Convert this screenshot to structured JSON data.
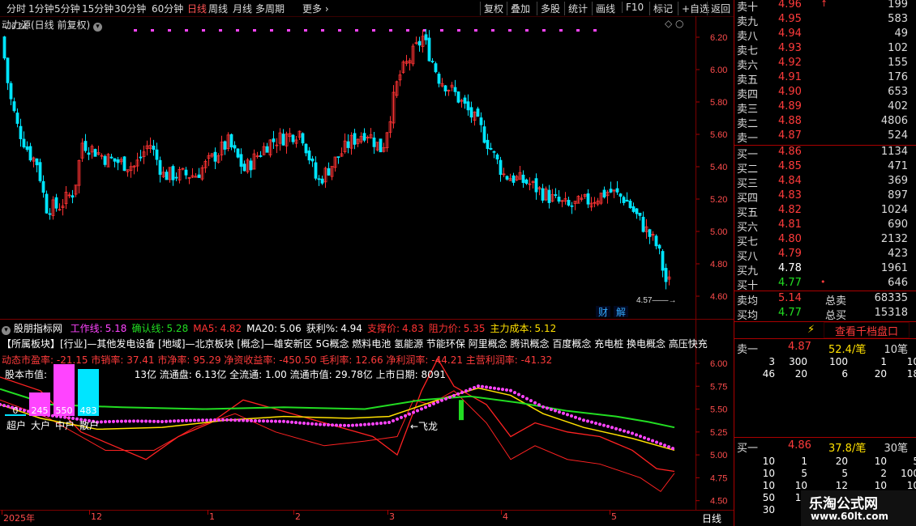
{
  "toolbar": {
    "tabs": [
      "分时",
      "1分钟",
      "5分钟",
      "15分钟",
      "30分钟",
      "60分钟",
      "日线",
      "周线",
      "月线",
      "多周期",
      "更多 ›"
    ],
    "active_tab": "日线",
    "buttons": [
      "复权",
      "叠加",
      "多股",
      "统计",
      "画线",
      "F10",
      "标记",
      "+自选",
      "返回"
    ]
  },
  "main_chart": {
    "title": "动力源(日线 前复权)",
    "max_label": "6.24",
    "min_label": "4.57",
    "badges": [
      "财",
      "解"
    ],
    "y_ticks": [
      "6.20",
      "6.00",
      "5.80",
      "5.60",
      "5.40",
      "5.20",
      "5.00",
      "4.80",
      "4.60"
    ],
    "colors": {
      "up": "#ff3333",
      "down": "#00e5ff",
      "dots": "#ff44ff"
    }
  },
  "indicator_header": {
    "name": "股朋指标网",
    "items": [
      {
        "label": "工作线:",
        "value": "5.18",
        "color": "#ff44ff"
      },
      {
        "label": "确认线:",
        "value": "5.28",
        "color": "#22dd22"
      },
      {
        "label": "MA5:",
        "value": "4.82",
        "color": "#ff3333"
      },
      {
        "label": "MA20:",
        "value": "5.06",
        "color": "#ffffff"
      },
      {
        "label": "获利%:",
        "value": "4.94",
        "color": "#ffffff"
      },
      {
        "label": "支撑价:",
        "value": "4.83",
        "color": "#ff3333"
      },
      {
        "label": "阻力价:",
        "value": "5.35",
        "color": "#ff3333"
      },
      {
        "label": "主力成本:",
        "value": "5.12",
        "color": "#ffe000"
      }
    ]
  },
  "sector_line": "【所属板块】[行业]—其他发电设备 [地域]—北京板块 [概念]—雄安新区 5G概念 燃料电池 氢能源 节能环保 阿里概念 腾讯概念 百度概念 充电桩 换电概念 高压快充",
  "finance_line": "动态市盈率: -21.15 市销率: 37.41 市净率: 95.29 净资收益率: -450.50 毛利率: 12.66 净利润率: -44.21 主营利润率: -41.32",
  "cap_line_prefix": "股本市值:",
  "cap_line_rest": "13亿 流通盘: 6.13亿 全流通: 1.00 流通市值: 29.78亿 上市日期: 8091",
  "holder_bars": [
    {
      "label": "超户",
      "value": "0",
      "level": 0.02,
      "color": "#00e5ff"
    },
    {
      "label": "大户",
      "value": "245",
      "level": 0.45,
      "color": "#ff44ff"
    },
    {
      "label": "中户",
      "value": "550",
      "level": 1.0,
      "color": "#ff44ff"
    },
    {
      "label": "散户",
      "value": "483",
      "level": 0.9,
      "color": "#00e5ff"
    }
  ],
  "flylong_label": "←飞龙",
  "ind_y_ticks": [
    "6.00",
    "5.75",
    "5.50",
    "5.25",
    "5.00",
    "4.75",
    "4.50"
  ],
  "x_labels": [
    "2025年",
    "12",
    "1",
    "2",
    "3",
    "4",
    "5"
  ],
  "period_label": "日线",
  "order_book": {
    "asks": [
      {
        "name": "卖十",
        "price": "4.96",
        "vol": "199",
        "mark": "↑"
      },
      {
        "name": "卖九",
        "price": "4.95",
        "vol": "583",
        "mark": ""
      },
      {
        "name": "卖八",
        "price": "4.94",
        "vol": "49",
        "mark": ""
      },
      {
        "name": "卖七",
        "price": "4.93",
        "vol": "102",
        "mark": ""
      },
      {
        "name": "卖六",
        "price": "4.92",
        "vol": "155",
        "mark": ""
      },
      {
        "name": "卖五",
        "price": "4.91",
        "vol": "176",
        "mark": ""
      },
      {
        "name": "卖四",
        "price": "4.90",
        "vol": "653",
        "mark": ""
      },
      {
        "name": "卖三",
        "price": "4.89",
        "vol": "402",
        "mark": ""
      },
      {
        "name": "卖二",
        "price": "4.88",
        "vol": "4806",
        "mark": ""
      },
      {
        "name": "卖一",
        "price": "4.87",
        "vol": "524",
        "mark": ""
      }
    ],
    "bids": [
      {
        "name": "买一",
        "price": "4.86",
        "vol": "1134",
        "color": "#ff3b3b",
        "mark": ""
      },
      {
        "name": "买二",
        "price": "4.85",
        "vol": "471",
        "color": "#ff3b3b",
        "mark": ""
      },
      {
        "name": "买三",
        "price": "4.84",
        "vol": "369",
        "color": "#ff3b3b",
        "mark": ""
      },
      {
        "name": "买四",
        "price": "4.83",
        "vol": "897",
        "color": "#ff3b3b",
        "mark": ""
      },
      {
        "name": "买五",
        "price": "4.82",
        "vol": "1024",
        "color": "#ff3b3b",
        "mark": ""
      },
      {
        "name": "买六",
        "price": "4.81",
        "vol": "690",
        "color": "#ff3b3b",
        "mark": ""
      },
      {
        "name": "买七",
        "price": "4.80",
        "vol": "2132",
        "color": "#ff3b3b",
        "mark": ""
      },
      {
        "name": "买八",
        "price": "4.79",
        "vol": "423",
        "color": "#ff3b3b",
        "mark": ""
      },
      {
        "name": "买九",
        "price": "4.78",
        "vol": "1961",
        "color": "#ffffff",
        "mark": ""
      },
      {
        "name": "买十",
        "price": "4.77",
        "vol": "646",
        "color": "#22dd22",
        "mark": "•"
      }
    ],
    "ask_avg": {
      "name": "卖均",
      "price": "5.14",
      "label": "总卖",
      "vol": "68335"
    },
    "bid_avg": {
      "name": "买均",
      "price": "4.77",
      "label": "总买",
      "vol": "15318"
    },
    "view_button": "查看千档盘口",
    "sell1": {
      "name": "卖一",
      "price": "4.87",
      "avg": "52.4/笔",
      "count": "10笔"
    },
    "sell_rows": [
      [
        "3",
        "300",
        "100",
        "1",
        "10"
      ],
      [
        "46",
        "20",
        "6",
        "20",
        "18"
      ]
    ],
    "buy1": {
      "name": "买一",
      "price": "4.86",
      "avg": "37.8/笔",
      "count": "30笔"
    },
    "buy_rows": [
      [
        "10",
        "1",
        "20",
        "10",
        "5"
      ],
      [
        "10",
        "5",
        "5",
        "2",
        "100"
      ],
      [
        "10",
        "10",
        "12",
        "10",
        "10"
      ],
      [
        "50",
        "10",
        "",
        "",
        ""
      ],
      [
        "30",
        "",
        "",
        "",
        ""
      ]
    ]
  },
  "watermark": {
    "title": "乐淘公式网",
    "url": "www.60lt.com"
  }
}
